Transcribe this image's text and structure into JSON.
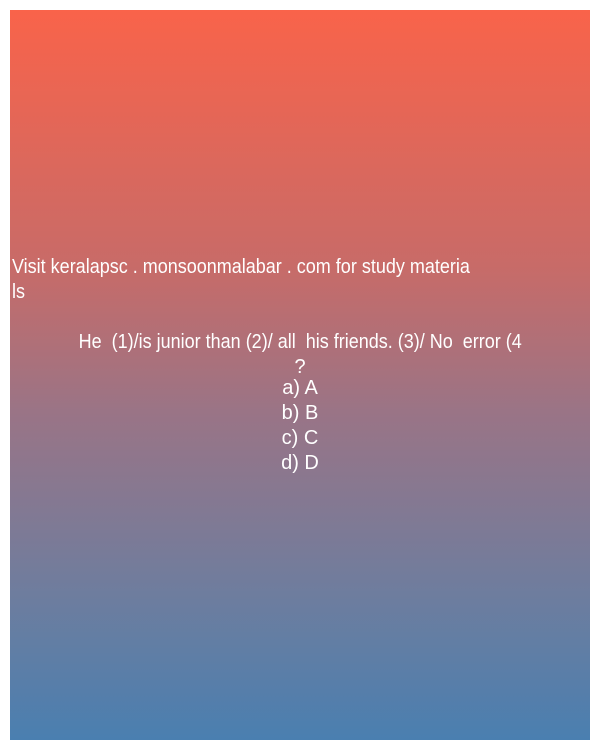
{
  "promo": {
    "line1": "Visit keralapsc . monsoonmalabar . com for study materia",
    "line2": "ls"
  },
  "question": {
    "line1": "He  (1)/is junior than (2)/ all  his friends. (3)/ No  error (4",
    "line2": "?"
  },
  "options": [
    "a) A",
    "b) B",
    "c) C",
    "d) D"
  ],
  "colors": {
    "gradient_top": "#F9634A",
    "gradient_bottom": "#4A7FB0",
    "text": "#FFFFFF"
  }
}
